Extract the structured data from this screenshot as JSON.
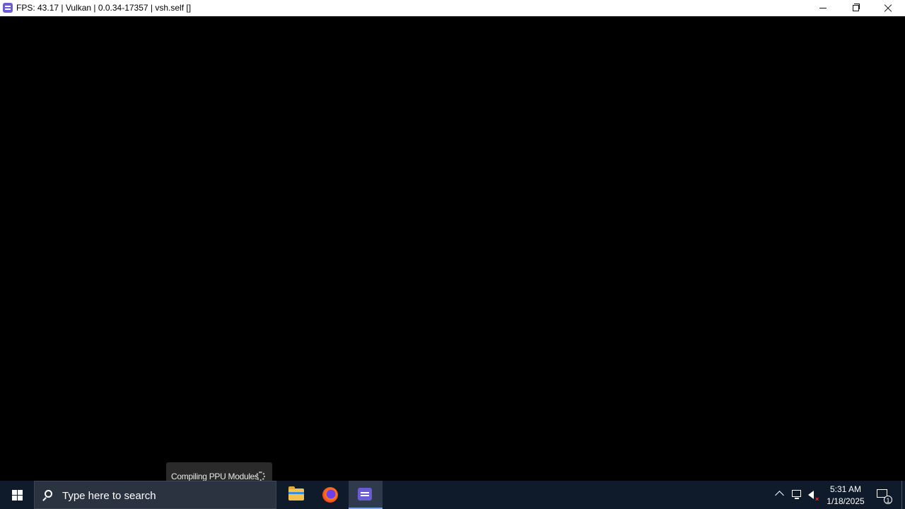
{
  "window": {
    "title": "FPS: 43.17 | Vulkan | 0.0.34-17357 | vsh.self []",
    "buttons": {
      "minimize": "minimize",
      "maximize": "restore",
      "close": "close"
    }
  },
  "overlay": {
    "toast_text": "Compiling PPU Modules",
    "spinner_icon": "loading-spinner-icon"
  },
  "taskbar": {
    "search_placeholder": "Type here to search",
    "apps": [
      {
        "name": "File Explorer",
        "icon": "folder-icon"
      },
      {
        "name": "Firefox",
        "icon": "firefox-icon"
      },
      {
        "name": "RPCS3",
        "icon": "rpcs3-icon",
        "active": true
      }
    ],
    "clock": {
      "time": "5:31 AM",
      "date": "1/18/2025"
    },
    "notification_count": "1"
  },
  "colors": {
    "titlebar_bg": "#ffffff",
    "viewport_bg": "#000000",
    "taskbar_bg": "#0f1b2a",
    "app_accent": "#6a5bd6"
  }
}
